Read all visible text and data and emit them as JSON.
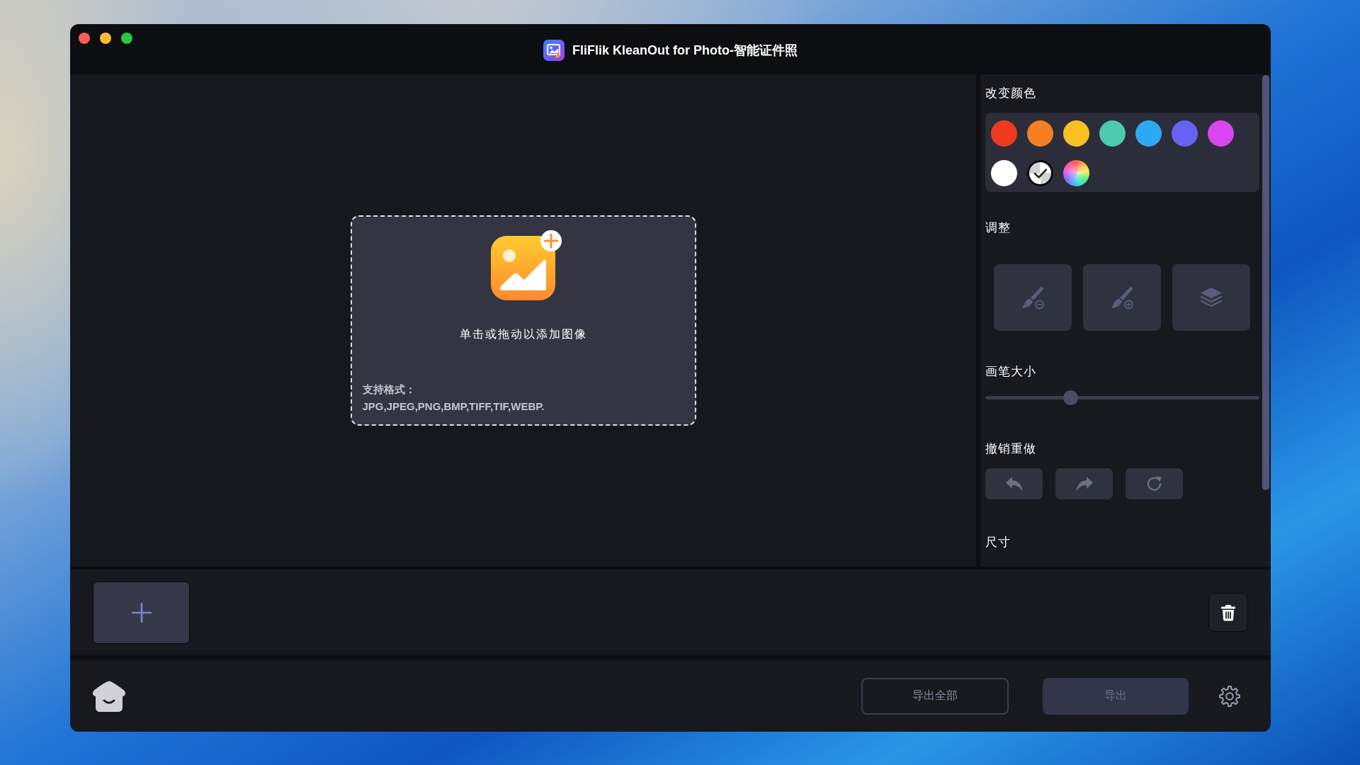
{
  "window": {
    "title": "FliFlik KleanOut for Photo-智能证件照"
  },
  "drop_zone": {
    "prompt": "单击或拖动以添加图像",
    "formats_label": "支持格式：",
    "formats": "JPG,JPEG,PNG,BMP,TIFF,TIF,WEBP."
  },
  "side_panel": {
    "color_section": {
      "heading": "改变颜色",
      "swatches": [
        {
          "kind": "solid",
          "color": "#f03a1f",
          "selected": false
        },
        {
          "kind": "solid",
          "color": "#f57f22",
          "selected": false
        },
        {
          "kind": "solid",
          "color": "#fbbf24",
          "selected": false
        },
        {
          "kind": "solid",
          "color": "#4ccab0",
          "selected": false
        },
        {
          "kind": "solid",
          "color": "#2ea9f6",
          "selected": false
        },
        {
          "kind": "solid",
          "color": "#6663f4",
          "selected": false
        },
        {
          "kind": "solid",
          "color": "#d746f1",
          "selected": false
        },
        {
          "kind": "solid",
          "color": "#ffffff",
          "selected": false
        },
        {
          "kind": "transparent",
          "selected": true
        },
        {
          "kind": "picker",
          "selected": false
        }
      ]
    },
    "adjust_section": {
      "heading": "调整",
      "tools": [
        {
          "kind": "erase-brush",
          "disabled": true
        },
        {
          "kind": "restore-brush",
          "disabled": true
        },
        {
          "kind": "layers",
          "disabled": true
        }
      ]
    },
    "brush_size": {
      "heading": "画笔大小",
      "level": 0.3
    },
    "history": {
      "heading": "撤销重做",
      "buttons": [
        {
          "kind": "undo",
          "disabled": true
        },
        {
          "kind": "redo",
          "disabled": true
        },
        {
          "kind": "reset",
          "disabled": true
        }
      ]
    },
    "size_section": {
      "heading": "尺寸"
    }
  },
  "footer": {
    "buttons": [
      {
        "kind": "outline",
        "label": "导出全部",
        "disabled": true
      },
      {
        "kind": "filled",
        "label": "导出",
        "disabled": true
      }
    ]
  }
}
